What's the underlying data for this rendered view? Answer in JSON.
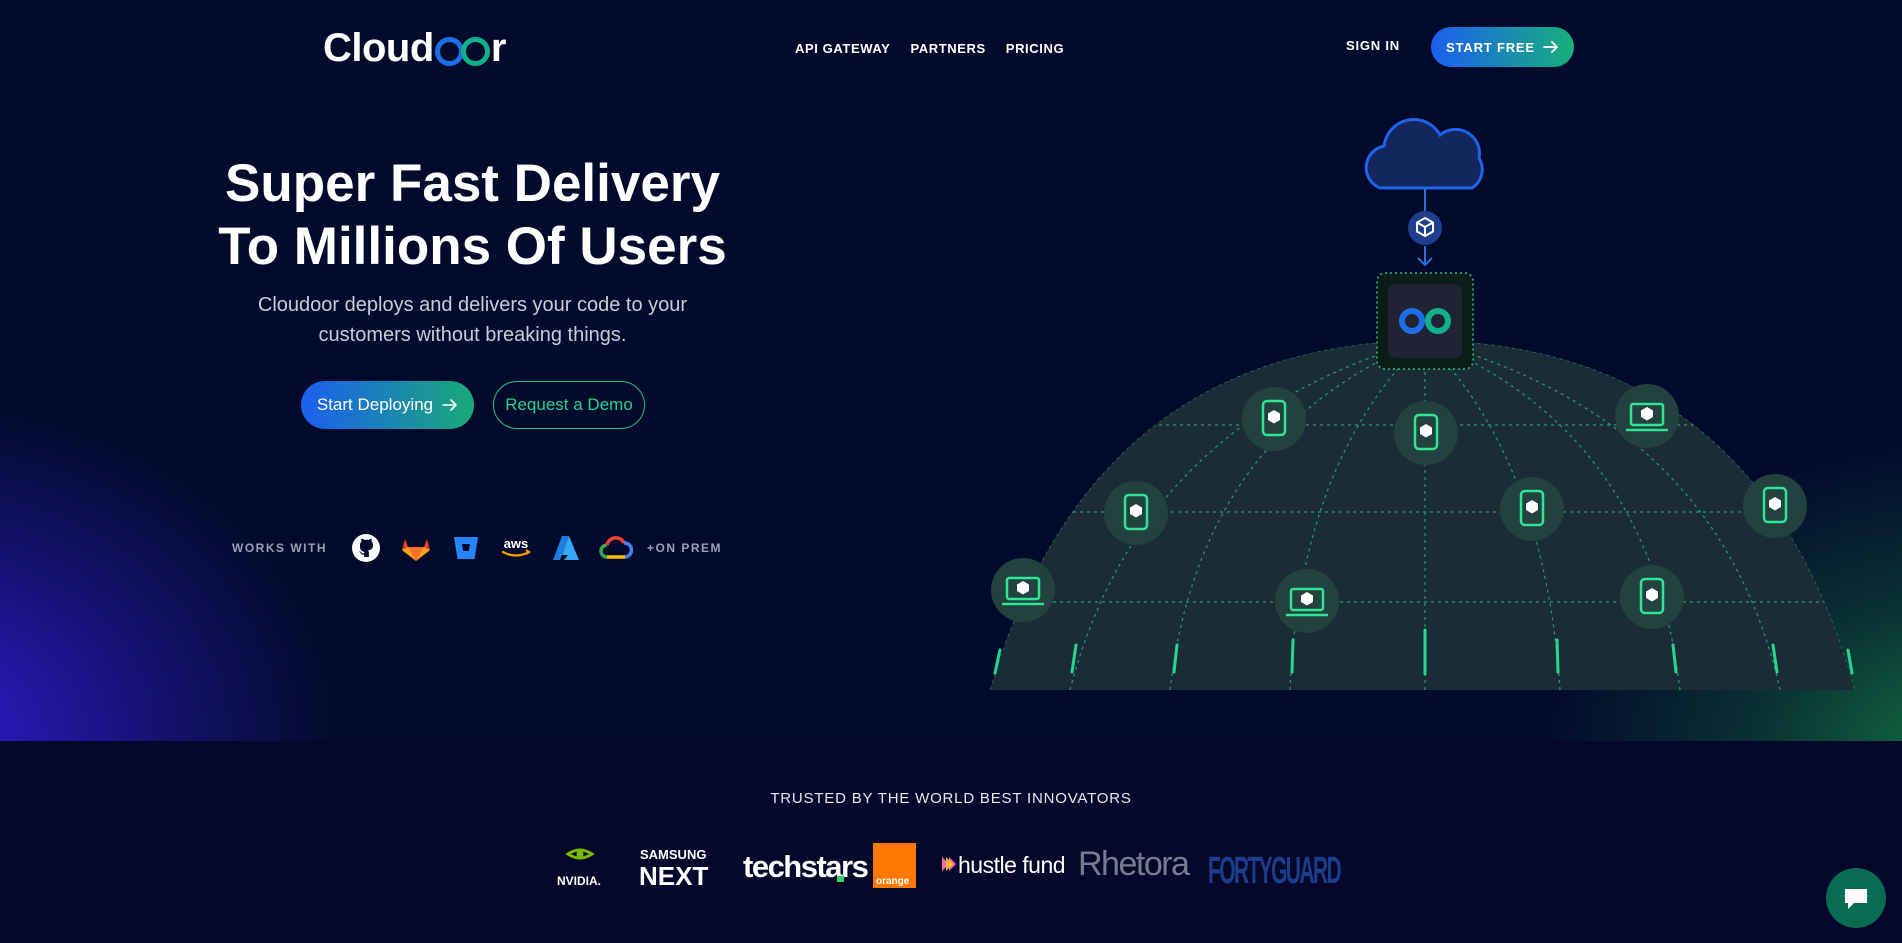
{
  "header": {
    "logo_prefix": "Cloud",
    "logo_suffix": "r",
    "nav": [
      "API GATEWAY",
      "PARTNERS",
      "PRICING"
    ],
    "sign_in": "SIGN IN",
    "start_free": "START FREE"
  },
  "hero": {
    "title_line1": "Super Fast Delivery",
    "title_line2": "To Millions Of Users",
    "subtitle_line1": "Cloudoor deploys and delivers your code to your",
    "subtitle_line2": "customers without breaking things.",
    "primary_cta": "Start Deploying",
    "secondary_cta": "Request a Demo",
    "works_with_label": "WORKS WITH",
    "integrations": [
      "github-icon",
      "gitlab-icon",
      "bitbucket-icon",
      "aws-icon",
      "azure-icon",
      "google-cloud-icon"
    ],
    "aws_text": "aws",
    "on_prem": "+ON PREM"
  },
  "trusted": {
    "title": "TRUSTED BY THE WORLD BEST INNOVATORS",
    "logos": {
      "nvidia": "NVIDIA.",
      "samsung_top": "SAMSUNG",
      "samsung_bottom": "NEXT",
      "techstars": "techstars",
      "orange": "orange",
      "hustle": "hustle fund",
      "rhetora": "Rhetora",
      "fortyguard": "FORTYGUARD"
    }
  },
  "colors": {
    "background": "#030b2c",
    "accent_blue": "#1c5ff0",
    "accent_green": "#1fbf84",
    "globe_fill": "#1c2c37"
  }
}
